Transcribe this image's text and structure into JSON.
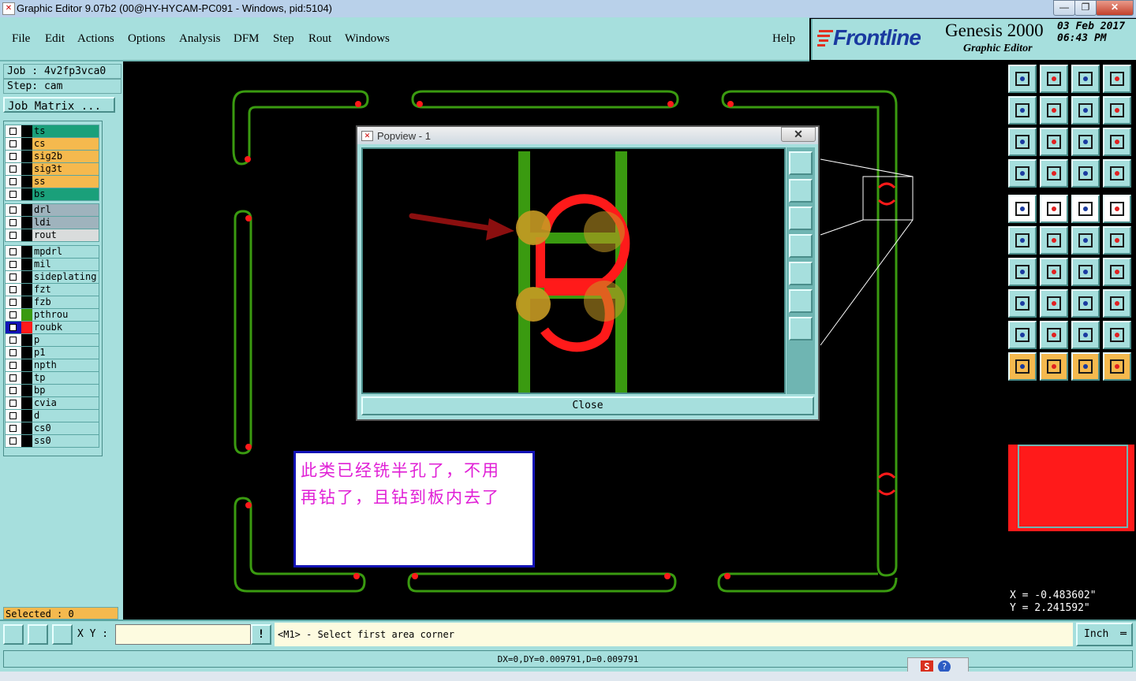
{
  "window": {
    "title": "Graphic Editor 9.07b2 (00@HY-HYCAM-PC091 - Windows, pid:5104)",
    "controls": [
      "—",
      "❐",
      "✕"
    ]
  },
  "menu": {
    "items": [
      "File",
      "Edit",
      "Actions",
      "Options",
      "Analysis",
      "DFM",
      "Step",
      "Rout",
      "Windows"
    ],
    "help": "Help"
  },
  "brand": {
    "logo": "Frontline",
    "product": "Genesis 2000",
    "subtitle": "Graphic Editor",
    "date": "03 Feb 2017",
    "time": "06:43 PM"
  },
  "job": {
    "job_label": "Job : 4v2fp3vca0",
    "step_label": "Step: cam",
    "matrix_button": "Job Matrix ..."
  },
  "layers": [
    {
      "name": "ts",
      "bg": "#1aa07a",
      "swatch": "#000000"
    },
    {
      "name": "cs",
      "bg": "#f5b94e",
      "swatch": "#000000"
    },
    {
      "name": "sig2b",
      "bg": "#f5b94e",
      "swatch": "#000000"
    },
    {
      "name": "sig3t",
      "bg": "#f5b94e",
      "swatch": "#000000"
    },
    {
      "name": "ss",
      "bg": "#f5b94e",
      "swatch": "#000000"
    },
    {
      "name": "bs",
      "bg": "#1aa07a",
      "swatch": "#000000"
    },
    {
      "name": "drl",
      "bg": "#9fb3bd",
      "swatch": "#000000"
    },
    {
      "name": "ldi",
      "bg": "#9fb3bd",
      "swatch": "#000000"
    },
    {
      "name": "rout",
      "bg": "#d9dcdc",
      "swatch": "#000000"
    },
    {
      "name": "mpdrl",
      "bg": "#a6dfdd",
      "swatch": "#000000"
    },
    {
      "name": "mil",
      "bg": "#a6dfdd",
      "swatch": "#000000"
    },
    {
      "name": "sideplating",
      "bg": "#a6dfdd",
      "swatch": "#000000"
    },
    {
      "name": "fzt",
      "bg": "#a6dfdd",
      "swatch": "#000000"
    },
    {
      "name": "fzb",
      "bg": "#a6dfdd",
      "swatch": "#000000"
    },
    {
      "name": "pthrou",
      "bg": "#a6dfdd",
      "swatch": "#3a9a10"
    },
    {
      "name": "roubk",
      "bg": "#a6dfdd",
      "swatch": "#ff1a1a",
      "checkbox": "#1313b6"
    },
    {
      "name": "p",
      "bg": "#a6dfdd",
      "swatch": "#000000"
    },
    {
      "name": "p1",
      "bg": "#a6dfdd",
      "swatch": "#000000"
    },
    {
      "name": "npth",
      "bg": "#a6dfdd",
      "swatch": "#000000"
    },
    {
      "name": "tp",
      "bg": "#a6dfdd",
      "swatch": "#000000"
    },
    {
      "name": "bp",
      "bg": "#a6dfdd",
      "swatch": "#000000"
    },
    {
      "name": "cvia",
      "bg": "#a6dfdd",
      "swatch": "#000000"
    },
    {
      "name": "d",
      "bg": "#a6dfdd",
      "swatch": "#000000"
    },
    {
      "name": "cs0",
      "bg": "#a6dfdd",
      "swatch": "#000000"
    },
    {
      "name": "ss0",
      "bg": "#a6dfdd",
      "swatch": "#000000"
    }
  ],
  "selected": "Selected : 0",
  "popview": {
    "title": "Popview - 1",
    "close_button": "Close"
  },
  "annotation": {
    "line1": "此类已经铣半孔了，不用",
    "line2": "再钻了，且钻到板内去了"
  },
  "coords": {
    "x": "X = -0.483602\"",
    "y": "Y = 2.241592\""
  },
  "command": {
    "xy_label": "X Y :",
    "xy_value": "",
    "prompt": "<M1> - Select first area corner",
    "units": "Inch"
  },
  "status": {
    "measure": "DX=0,DY=0.009791,D=0.009791"
  },
  "colors": {
    "panel": "#a6dfdd",
    "outline": "#3a9a10",
    "rout": "#ff1a1a",
    "note_text": "#e01fd6",
    "note_border": "#1313b6"
  }
}
